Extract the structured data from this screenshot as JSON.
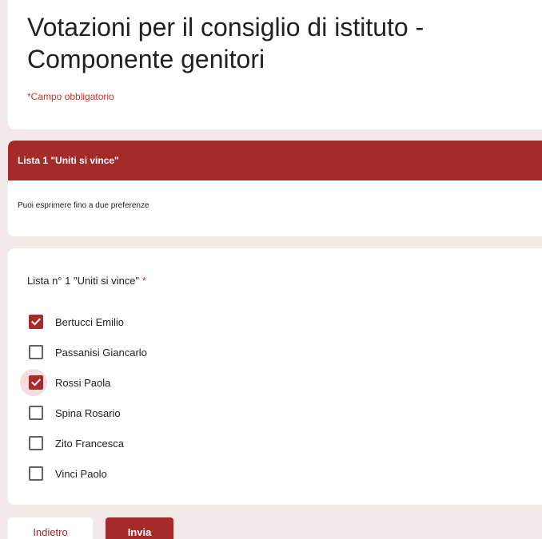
{
  "form": {
    "title": "Votazioni per il consiglio di istituto - Componente genitori",
    "required_note": "*Campo obbligatorio"
  },
  "section": {
    "title": "Lista 1 \"Uniti si vince\"",
    "description": "Puoi esprimere fino a due preferenze"
  },
  "question": {
    "title": "Lista n° 1 \"Uniti si vince\"",
    "required_marker": "*",
    "options": [
      {
        "label": "Bertucci Emilio",
        "checked": true
      },
      {
        "label": "Passanisi Giancarlo",
        "checked": false
      },
      {
        "label": "Rossi Paola",
        "checked": true,
        "focused": true
      },
      {
        "label": "Spina Rosario",
        "checked": false
      },
      {
        "label": "Zito Francesca",
        "checked": false
      },
      {
        "label": "Vinci Paolo",
        "checked": false
      }
    ]
  },
  "buttons": {
    "back_label": "Indietro",
    "submit_label": "Invia"
  },
  "colors": {
    "accent": "#a52a2a",
    "background": "#f2e9e9",
    "required": "#d93025"
  }
}
